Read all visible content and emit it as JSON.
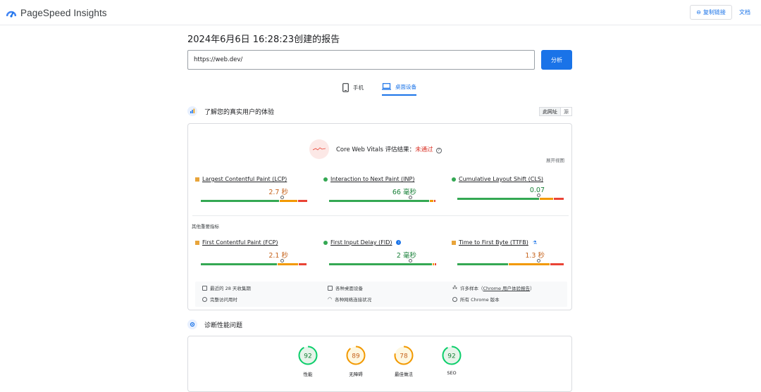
{
  "header": {
    "app_title": "PageSpeed Insights",
    "copy_link": "复制链接",
    "docs": "文档"
  },
  "report": {
    "title": "2024年6月6日 16:28:23创建的报告",
    "url_value": "https://web.dev/",
    "analyze": "分析"
  },
  "tabs": [
    {
      "label": "手机",
      "icon": "phone-icon",
      "active": false
    },
    {
      "label": "桌面设备",
      "icon": "laptop-icon",
      "active": true
    }
  ],
  "field_section": {
    "title": "了解您的真实用户的体验",
    "this_url": "此网址",
    "origin": "源",
    "cwv_label": "Core Web Vitals 评估结果：",
    "cwv_result": "未通过",
    "expand": "展开视图",
    "other_metrics": "其他重要指标",
    "metrics": [
      {
        "name": "Largest Contentful Paint (LCP)",
        "value": "2.7 秒",
        "status": "needs-improvement",
        "dist": [
          0.74,
          0.17,
          0.09
        ],
        "p75": 0.76
      },
      {
        "name": "Interaction to Next Paint (INP)",
        "value": "66 毫秒",
        "status": "good",
        "dist": [
          0.94,
          0.04,
          0.02
        ],
        "p75": 0.76
      },
      {
        "name": "Cumulative Layout Shift (CLS)",
        "value": "0.07",
        "status": "good",
        "dist": [
          0.77,
          0.13,
          0.1
        ],
        "p75": 0.76
      },
      {
        "name": "First Contentful Paint (FCP)",
        "value": "2.1 秒",
        "status": "needs-improvement",
        "dist": [
          0.72,
          0.2,
          0.08
        ],
        "p75": 0.76
      },
      {
        "name": "First Input Delay (FID)",
        "value": "2 毫秒",
        "status": "good",
        "dist": [
          0.98,
          0.01,
          0.01
        ],
        "p75": 0.76
      },
      {
        "name": "Time to First Byte (TTFB)",
        "value": "1.3 秒",
        "status": "needs-improvement",
        "dist": [
          0.48,
          0.39,
          0.13
        ],
        "p75": 0.76
      }
    ],
    "info": {
      "period": "最近的 28 天收集期",
      "devices": "各种桌面设备",
      "samples_prefix": "许多样本（",
      "samples_link": "Chrome 用户体验报告",
      "samples_suffix": "）",
      "duration": "完整访问用时",
      "network": "各种网络连接状况",
      "versions": "所有 Chrome 版本"
    }
  },
  "lab_section": {
    "title": "诊断性能问题",
    "scores": [
      {
        "label": "性能",
        "score": "92",
        "color": "#0cce6b"
      },
      {
        "label": "无障碍",
        "score": "89",
        "color": "#f29900"
      },
      {
        "label": "最佳做法",
        "score": "78",
        "color": "#f29900"
      },
      {
        "label": "SEO",
        "score": "92",
        "color": "#0cce6b"
      }
    ]
  }
}
